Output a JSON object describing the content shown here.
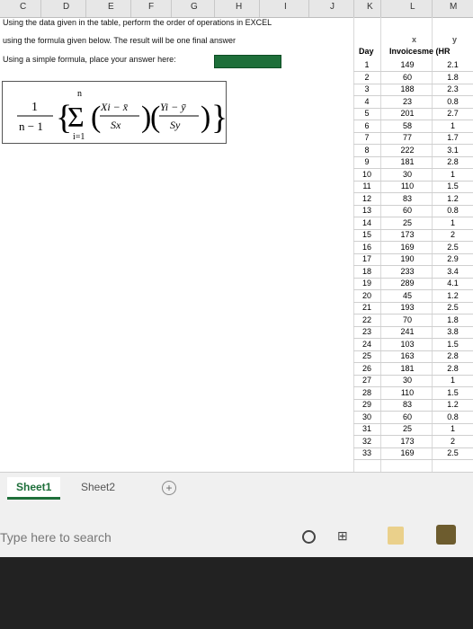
{
  "column_headers": [
    "C",
    "D",
    "E",
    "F",
    "G",
    "H",
    "I",
    "J",
    "K",
    "L",
    "M"
  ],
  "instructions": [
    "Using the data given in the table, perform the order of operations in EXCEL",
    "using the formula given below. The result will be one final answer",
    "Using a simple formula, place your answer here:"
  ],
  "formula": {
    "lead_num": "1",
    "lead_den": "n − 1",
    "sum_top": "n",
    "sum_bottom": "i=1",
    "x_num": "Xi − x̄",
    "x_den": "Sx",
    "y_num": "Yi − ȳ",
    "y_den": "Sy"
  },
  "table": {
    "sub_x": "x",
    "sub_y": "y",
    "col1": "Day",
    "col2": "Invoicesme (HR",
    "rows": [
      [
        "1",
        "149",
        "2.1"
      ],
      [
        "2",
        "60",
        "1.8"
      ],
      [
        "3",
        "188",
        "2.3"
      ],
      [
        "4",
        "23",
        "0.8"
      ],
      [
        "5",
        "201",
        "2.7"
      ],
      [
        "6",
        "58",
        "1"
      ],
      [
        "7",
        "77",
        "1.7"
      ],
      [
        "8",
        "222",
        "3.1"
      ],
      [
        "9",
        "181",
        "2.8"
      ],
      [
        "10",
        "30",
        "1"
      ],
      [
        "11",
        "110",
        "1.5"
      ],
      [
        "12",
        "83",
        "1.2"
      ],
      [
        "13",
        "60",
        "0.8"
      ],
      [
        "14",
        "25",
        "1"
      ],
      [
        "15",
        "173",
        "2"
      ],
      [
        "16",
        "169",
        "2.5"
      ],
      [
        "17",
        "190",
        "2.9"
      ],
      [
        "18",
        "233",
        "3.4"
      ],
      [
        "19",
        "289",
        "4.1"
      ],
      [
        "20",
        "45",
        "1.2"
      ],
      [
        "21",
        "193",
        "2.5"
      ],
      [
        "22",
        "70",
        "1.8"
      ],
      [
        "23",
        "241",
        "3.8"
      ],
      [
        "24",
        "103",
        "1.5"
      ],
      [
        "25",
        "163",
        "2.8"
      ],
      [
        "26",
        "181",
        "2.8"
      ],
      [
        "27",
        "30",
        "1"
      ],
      [
        "28",
        "110",
        "1.5"
      ],
      [
        "29",
        "83",
        "1.2"
      ],
      [
        "30",
        "60",
        "0.8"
      ],
      [
        "31",
        "25",
        "1"
      ],
      [
        "32",
        "173",
        "2"
      ],
      [
        "33",
        "169",
        "2.5"
      ]
    ]
  },
  "tabs": [
    "Sheet1",
    "Sheet2"
  ],
  "add_sheet": "+",
  "search_placeholder": "Type here to search"
}
